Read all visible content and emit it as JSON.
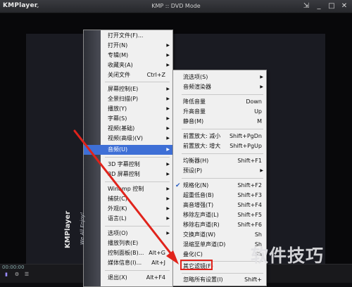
{
  "window": {
    "logo": "KMPlayer",
    "title": "KMP :: DVD Mode",
    "time": "00:00:00"
  },
  "main_menu": {
    "brand": "KMPlayer",
    "tagline": "We All Enjoy!",
    "items": [
      {
        "label": "打开文件(F)...",
        "shortcut": "",
        "arrow": false
      },
      {
        "label": "打开(N)",
        "shortcut": "",
        "arrow": true
      },
      {
        "label": "专辑(M)",
        "shortcut": "",
        "arrow": true
      },
      {
        "label": "收藏夹(A)",
        "shortcut": "",
        "arrow": true
      },
      {
        "label": "关闭文件",
        "shortcut": "Ctrl+Z",
        "arrow": false
      },
      {
        "label": "屏幕控制(E)",
        "shortcut": "",
        "arrow": true
      },
      {
        "label": "全景扫描(P)",
        "shortcut": "",
        "arrow": true
      },
      {
        "label": "播放(Y)",
        "shortcut": "",
        "arrow": true
      },
      {
        "label": "字幕(S)",
        "shortcut": "",
        "arrow": true
      },
      {
        "label": "视频(基础)",
        "shortcut": "",
        "arrow": true
      },
      {
        "label": "视频(高级)(V)",
        "shortcut": "",
        "arrow": true
      },
      {
        "label": "音频(U)",
        "shortcut": "",
        "arrow": true
      },
      {
        "label": "3D 字幕控制",
        "shortcut": "",
        "arrow": true
      },
      {
        "label": "3D 屏幕控制",
        "shortcut": "",
        "arrow": true
      },
      {
        "label": "Winamp 控制",
        "shortcut": "",
        "arrow": true
      },
      {
        "label": "捕获(C)",
        "shortcut": "",
        "arrow": true
      },
      {
        "label": "外观(K)",
        "shortcut": "",
        "arrow": true
      },
      {
        "label": "语言(L)",
        "shortcut": "",
        "arrow": true
      },
      {
        "label": "选项(O)",
        "shortcut": "",
        "arrow": true
      },
      {
        "label": "播放列表(E)",
        "shortcut": "",
        "arrow": false
      },
      {
        "label": "控制面板(B)...",
        "shortcut": "Alt+G",
        "arrow": false
      },
      {
        "label": "媒体信息(I)...",
        "shortcut": "Alt+J",
        "arrow": false
      },
      {
        "label": "退出(X)",
        "shortcut": "Alt+F4",
        "arrow": false
      }
    ]
  },
  "audio_submenu": {
    "items": [
      {
        "label": "流选项(S)",
        "shortcut": "",
        "arrow": true,
        "checked": false
      },
      {
        "label": "音频渲染器",
        "shortcut": "",
        "arrow": true,
        "checked": false
      },
      {
        "label": "降低音量",
        "shortcut": "Down",
        "arrow": false,
        "checked": false
      },
      {
        "label": "升高音量",
        "shortcut": "Up",
        "arrow": false,
        "checked": false
      },
      {
        "label": "静音(M)",
        "shortcut": "M",
        "arrow": false,
        "checked": false
      },
      {
        "label": "前置放大: 减小",
        "shortcut": "Shift+PgDn",
        "arrow": false,
        "checked": false
      },
      {
        "label": "前置放大: 增大",
        "shortcut": "Shift+PgUp",
        "arrow": false,
        "checked": false
      },
      {
        "label": "均衡器(H)",
        "shortcut": "Shift+F1",
        "arrow": false,
        "checked": false
      },
      {
        "label": "预设(P)",
        "shortcut": "",
        "arrow": true,
        "checked": false
      },
      {
        "label": "规格化(N)",
        "shortcut": "Shift+F2",
        "arrow": false,
        "checked": true
      },
      {
        "label": "超重低音(B)",
        "shortcut": "Shift+F3",
        "arrow": false,
        "checked": false
      },
      {
        "label": "高音增强(T)",
        "shortcut": "Shift+F4",
        "arrow": false,
        "checked": false
      },
      {
        "label": "移除左声道(L)",
        "shortcut": "Shift+F5",
        "arrow": false,
        "checked": false
      },
      {
        "label": "移除右声道(R)",
        "shortcut": "Shift+F6",
        "arrow": false,
        "checked": false
      },
      {
        "label": "交换声道(W)",
        "shortcut": "Sh",
        "arrow": false,
        "checked": false
      },
      {
        "label": "混缩至单声道(D)",
        "shortcut": "Sh",
        "arrow": false,
        "checked": false
      },
      {
        "label": "叠化(C)",
        "shortcut": "Sh",
        "arrow": false,
        "checked": false
      },
      {
        "label": "其它滤镜(F)",
        "shortcut": "",
        "arrow": false,
        "checked": false
      },
      {
        "label": "忽略所有设置(I)",
        "shortcut": "Shift+",
        "arrow": false,
        "checked": false
      }
    ]
  },
  "watermark": {
    "text": "软件技巧"
  },
  "colors": {
    "highlight": "#3e6fd6",
    "annotation": "#e0231b"
  }
}
